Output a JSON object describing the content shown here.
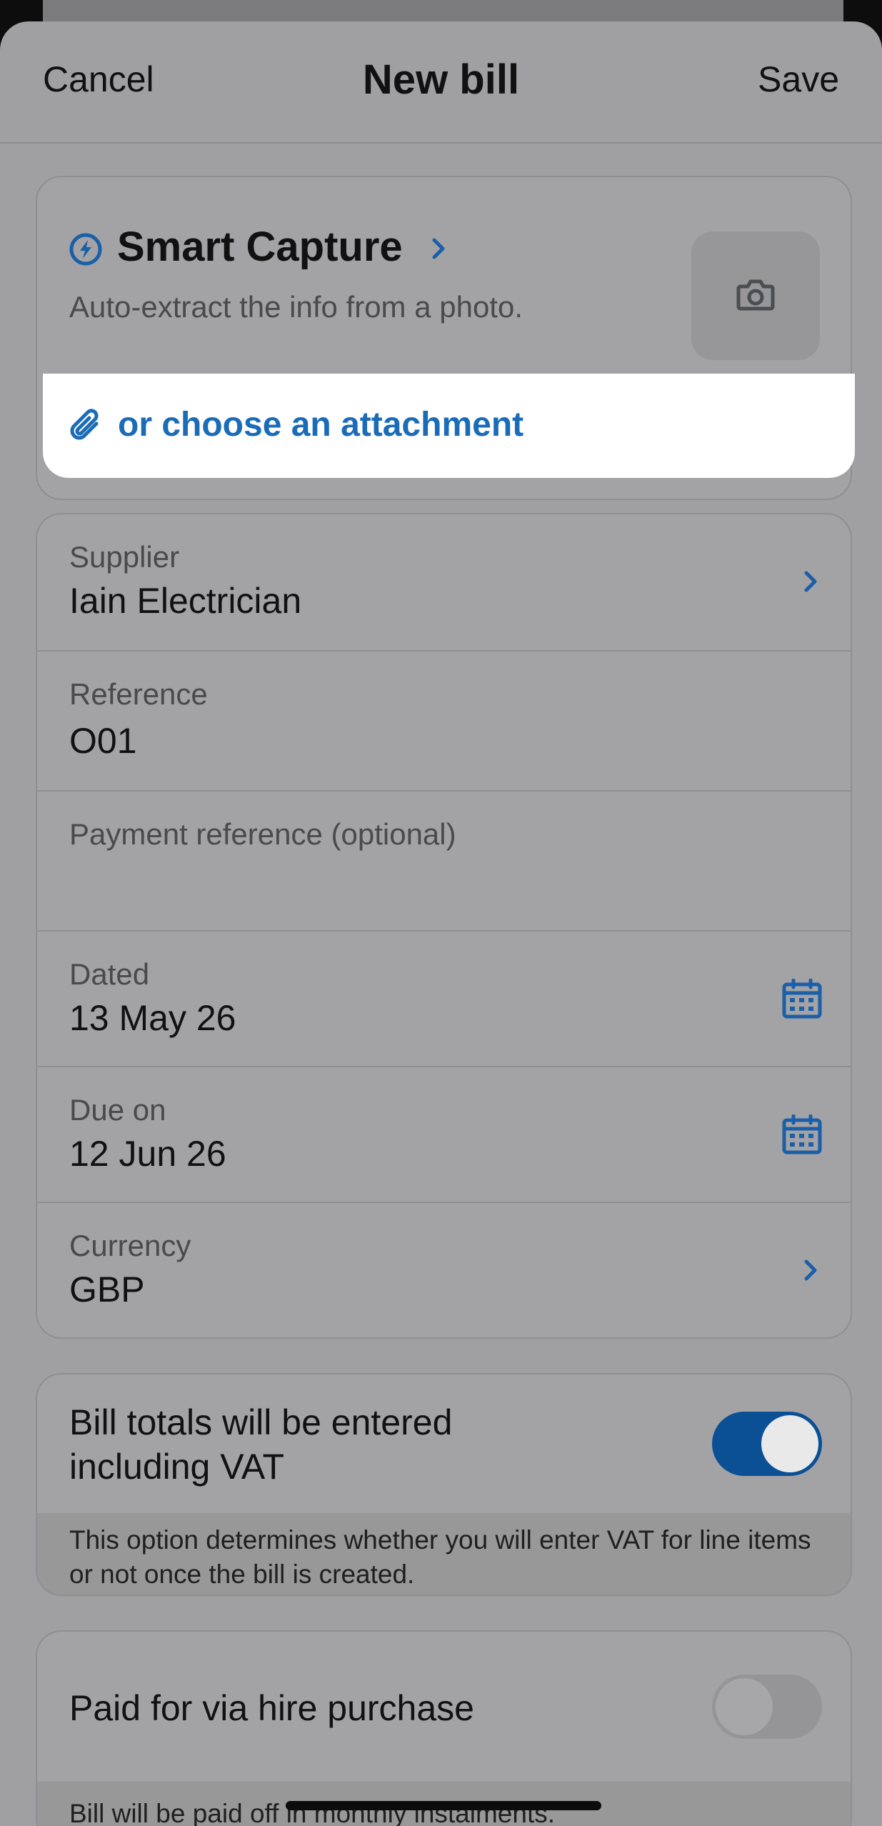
{
  "header": {
    "cancel_label": "Cancel",
    "title": "New bill",
    "save_label": "Save"
  },
  "smart_capture": {
    "title": "Smart Capture",
    "subtitle": "Auto-extract the info from a photo.",
    "attachment_label": "or choose an attachment",
    "icons": [
      "bolt-circle-icon",
      "chevron-right-icon",
      "camera-icon",
      "paperclip-icon"
    ]
  },
  "fields": {
    "supplier": {
      "label": "Supplier",
      "value": "Iain Electrician"
    },
    "reference": {
      "label": "Reference",
      "value": "O01"
    },
    "payment_reference": {
      "label": "Payment reference (optional)",
      "value": ""
    },
    "dated": {
      "label": "Dated",
      "value": "13 May 26"
    },
    "due_on": {
      "label": "Due on",
      "value": "12 Jun 26"
    },
    "currency": {
      "label": "Currency",
      "value": "GBP"
    }
  },
  "vat_toggle": {
    "label": "Bill totals will be entered including VAT",
    "on": true,
    "note": "This option determines whether you will enter VAT for line items or not once the bill is created."
  },
  "hire_purchase": {
    "label": "Paid for via hire purchase",
    "on": false,
    "note": "Bill will be paid off in monthly instalments."
  },
  "colors": {
    "accent": "#1a6bb8",
    "toggle_on": "#0b4f95",
    "overlay_bg": "#a0a0a2"
  }
}
